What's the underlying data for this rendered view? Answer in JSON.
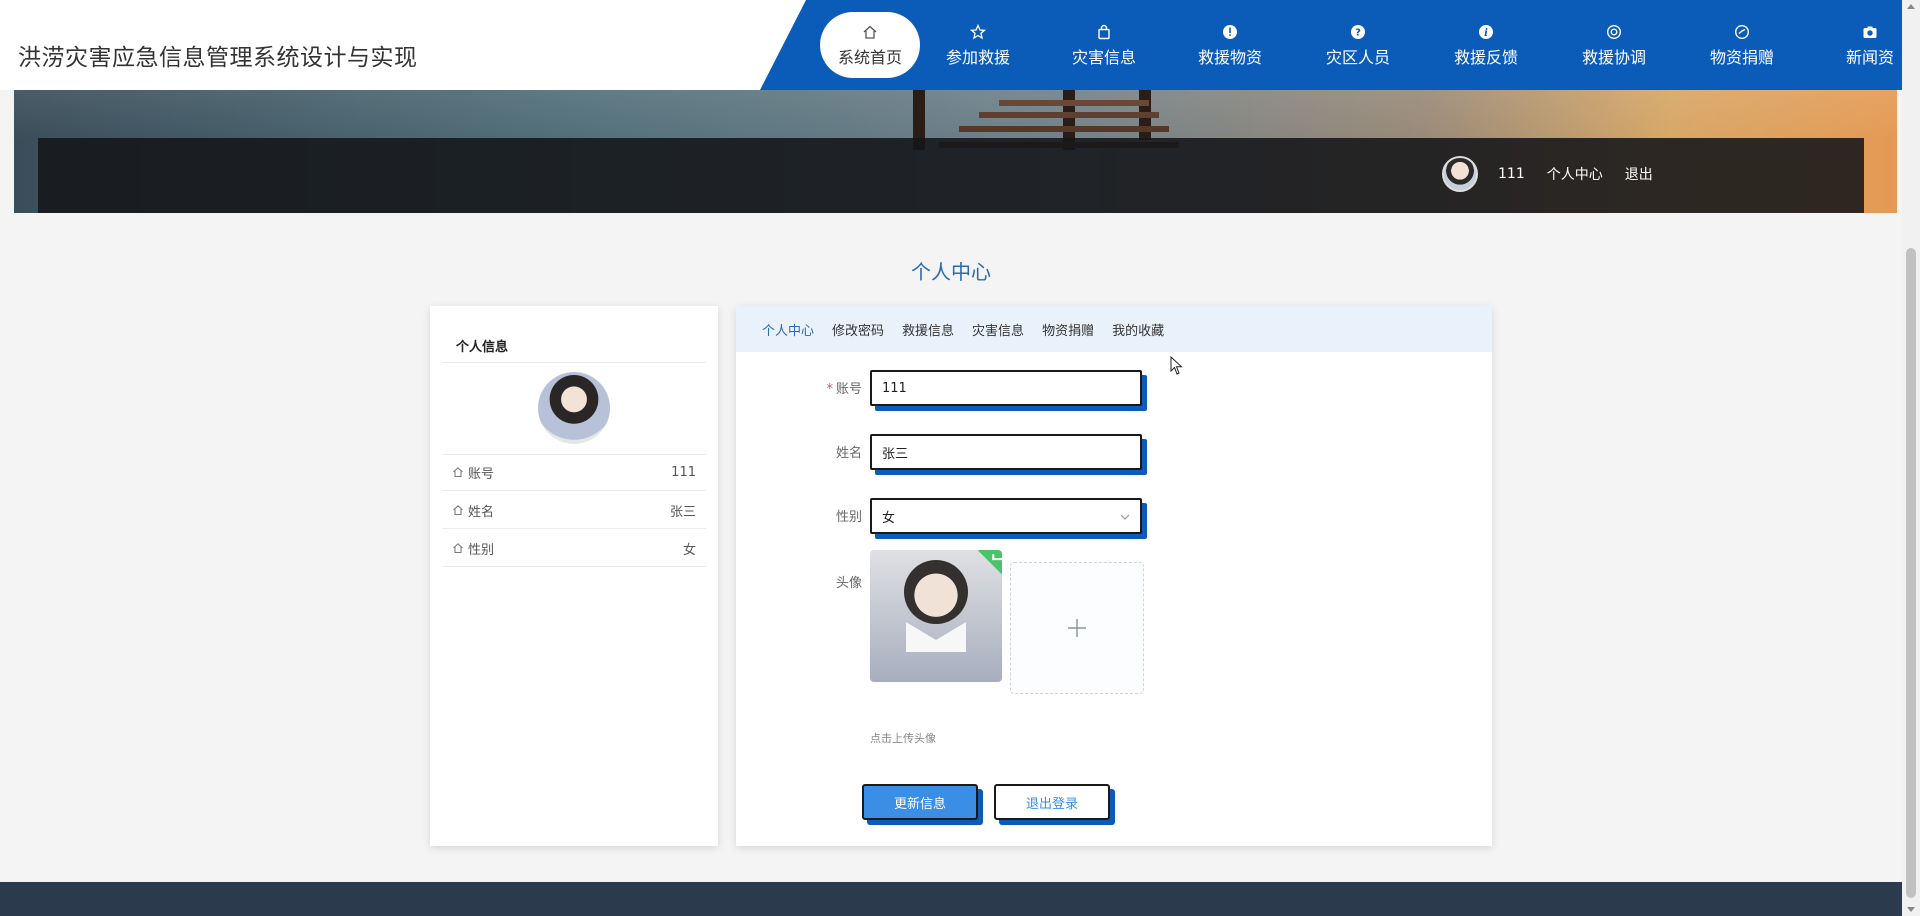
{
  "header": {
    "title": "洪涝灾害应急信息管理系统设计与实现",
    "nav": [
      {
        "label": "系统首页",
        "icon": "home-icon"
      },
      {
        "label": "参加救援",
        "icon": "star-icon"
      },
      {
        "label": "灾害信息",
        "icon": "bag-icon"
      },
      {
        "label": "救援物资",
        "icon": "alert-icon"
      },
      {
        "label": "灾区人员",
        "icon": "question-icon"
      },
      {
        "label": "救援反馈",
        "icon": "info-icon"
      },
      {
        "label": "救援协调",
        "icon": "lifebuoy-icon"
      },
      {
        "label": "物资捐赠",
        "icon": "gauge-icon"
      },
      {
        "label": "新闻资",
        "icon": "camera-icon"
      }
    ]
  },
  "user_bar": {
    "username": "111",
    "center_link": "个人中心",
    "logout_link": "退出"
  },
  "page_title": "个人中心",
  "profile_card": {
    "heading": "个人信息",
    "rows": [
      {
        "label": "账号",
        "value": "111"
      },
      {
        "label": "姓名",
        "value": "张三"
      },
      {
        "label": "性别",
        "value": "女"
      }
    ]
  },
  "tabs": [
    "个人中心",
    "修改密码",
    "救援信息",
    "灾害信息",
    "物资捐赠",
    "我的收藏"
  ],
  "form": {
    "account_label": "账号",
    "account_value": "111",
    "name_label": "姓名",
    "name_value": "张三",
    "gender_label": "性别",
    "gender_value": "女",
    "avatar_label": "头像",
    "upload_tip": "点击上传头像",
    "update_button": "更新信息",
    "logout_button": "退出登录"
  },
  "colors": {
    "nav_blue": "#0a5cb8",
    "accent": "#3a8ee6",
    "footer": "#2c3a4e"
  }
}
